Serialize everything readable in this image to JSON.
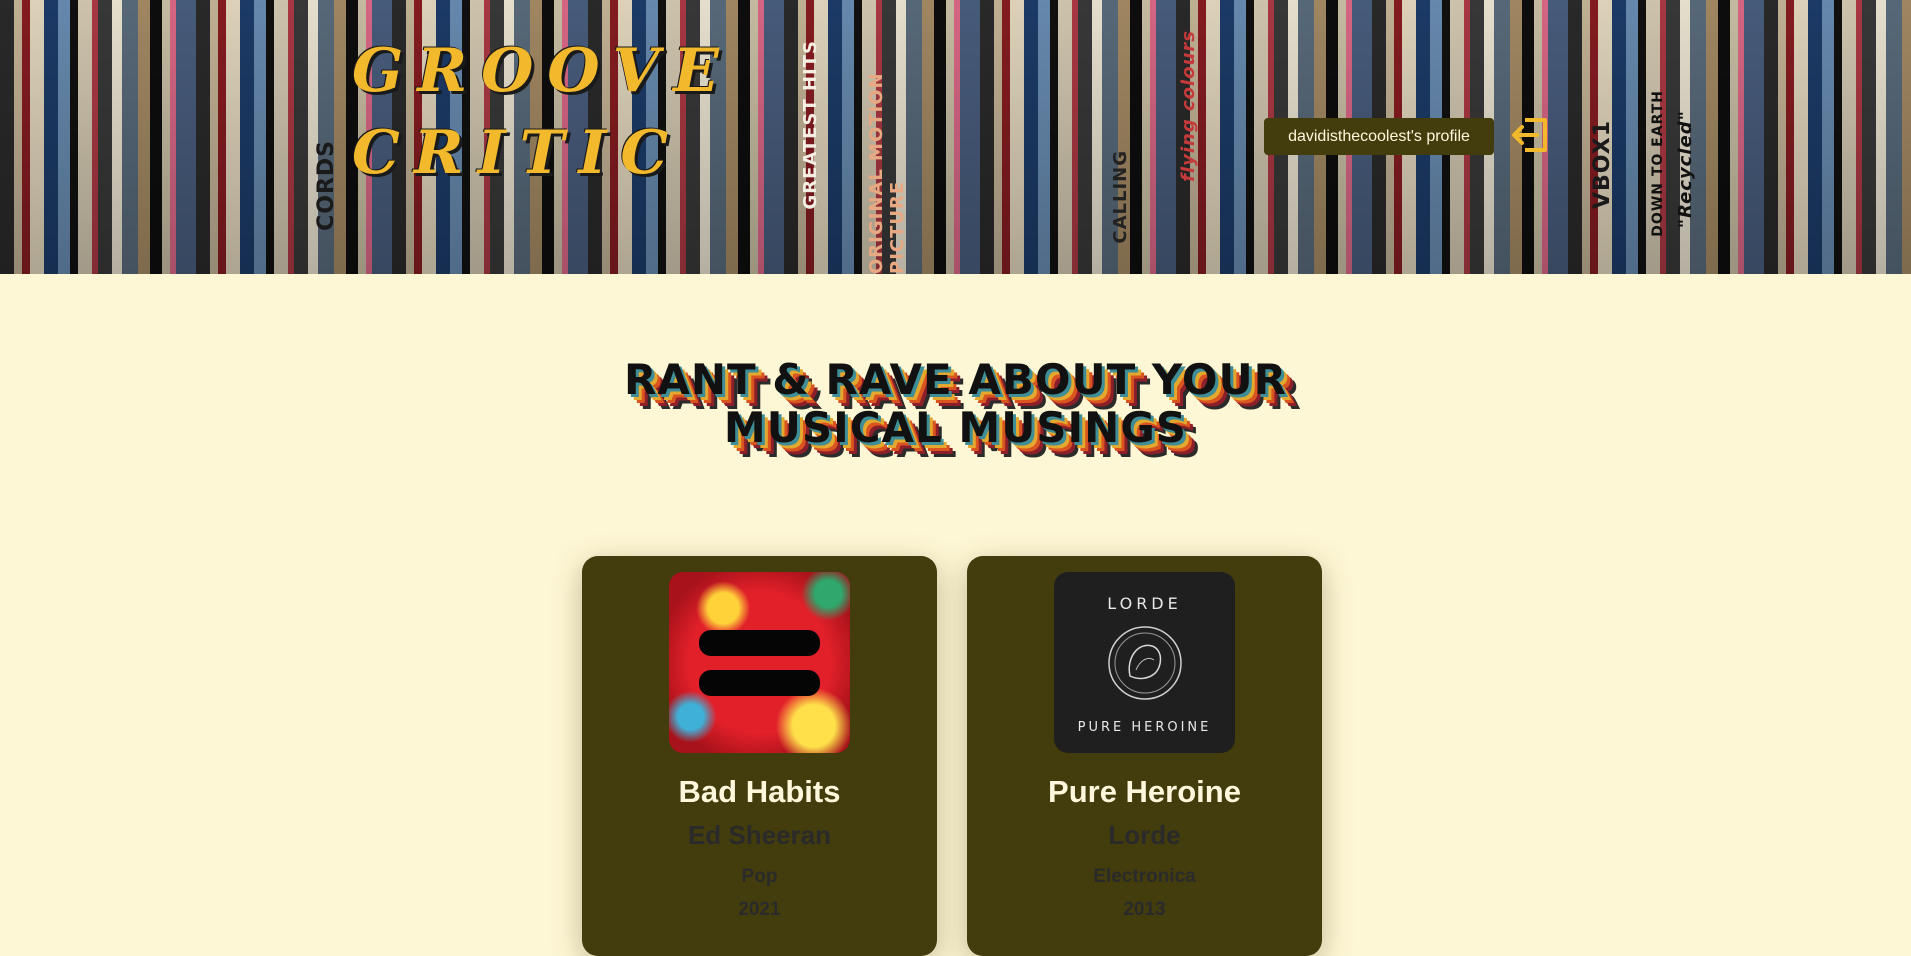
{
  "header": {
    "logo_line1": "GROOVE",
    "logo_line2": "CRITIC",
    "profile_label": "davidisthecoolest's profile",
    "logout_icon": "logout-icon",
    "spines": [
      "CALLING",
      "GREATEST HITS",
      "ORIGINAL MOTION PICTURE",
      "flying colours",
      "DOWN TO EARTH",
      "\"Recycled\"",
      "VBOX1",
      "CORDS"
    ]
  },
  "tagline": {
    "line1": "RANT & RAVE ABOUT YOUR",
    "line2": "MUSICAL MUSINGS"
  },
  "albums": [
    {
      "title": "Bad Habits",
      "artist": "Ed Sheeran",
      "genre": "Pop",
      "year": "2021"
    },
    {
      "title": "Pure Heroine",
      "artist": "Lorde",
      "genre": "Electronica",
      "year": "2013",
      "cover_top": "LORDE",
      "cover_bottom": "PURE HEROINE"
    }
  ],
  "colors": {
    "background": "#fef7d5",
    "card": "#433c0d",
    "accent": "#f1b92b"
  }
}
